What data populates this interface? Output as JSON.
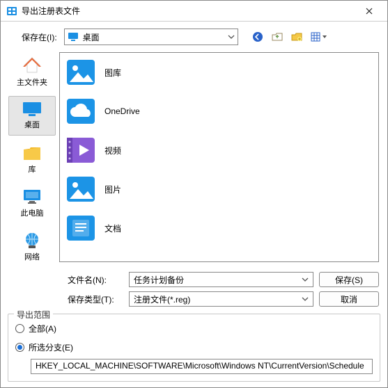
{
  "title": "导出注册表文件",
  "savein_label": "保存在(I):",
  "location_name": "桌面",
  "toolbar": {
    "back": "后退",
    "up": "上一层",
    "newfolder": "新建文件夹",
    "viewmenu": "视图"
  },
  "places": [
    {
      "label": "主文件夹",
      "kind": "home"
    },
    {
      "label": "桌面",
      "kind": "desktop",
      "selected": true
    },
    {
      "label": "库",
      "kind": "libraries"
    },
    {
      "label": "此电脑",
      "kind": "thispc"
    },
    {
      "label": "网络",
      "kind": "network"
    }
  ],
  "files": [
    {
      "label": "图库",
      "kind": "gallery"
    },
    {
      "label": "OneDrive",
      "kind": "onedrive"
    },
    {
      "label": "视频",
      "kind": "videos"
    },
    {
      "label": "图片",
      "kind": "pictures"
    },
    {
      "label": "文档",
      "kind": "documents"
    }
  ],
  "filename_label": "文件名(N):",
  "filename_value": "任务计划备份",
  "filetype_label": "保存类型(T):",
  "filetype_value": "注册文件(*.reg)",
  "save_button": "保存(S)",
  "cancel_button": "取消",
  "scope": {
    "group_title": "导出范围",
    "all_label": "全部(A)",
    "selected_label": "所选分支(E)",
    "mode": "selected",
    "branch": "HKEY_LOCAL_MACHINE\\SOFTWARE\\Microsoft\\Windows NT\\CurrentVersion\\Schedule"
  }
}
